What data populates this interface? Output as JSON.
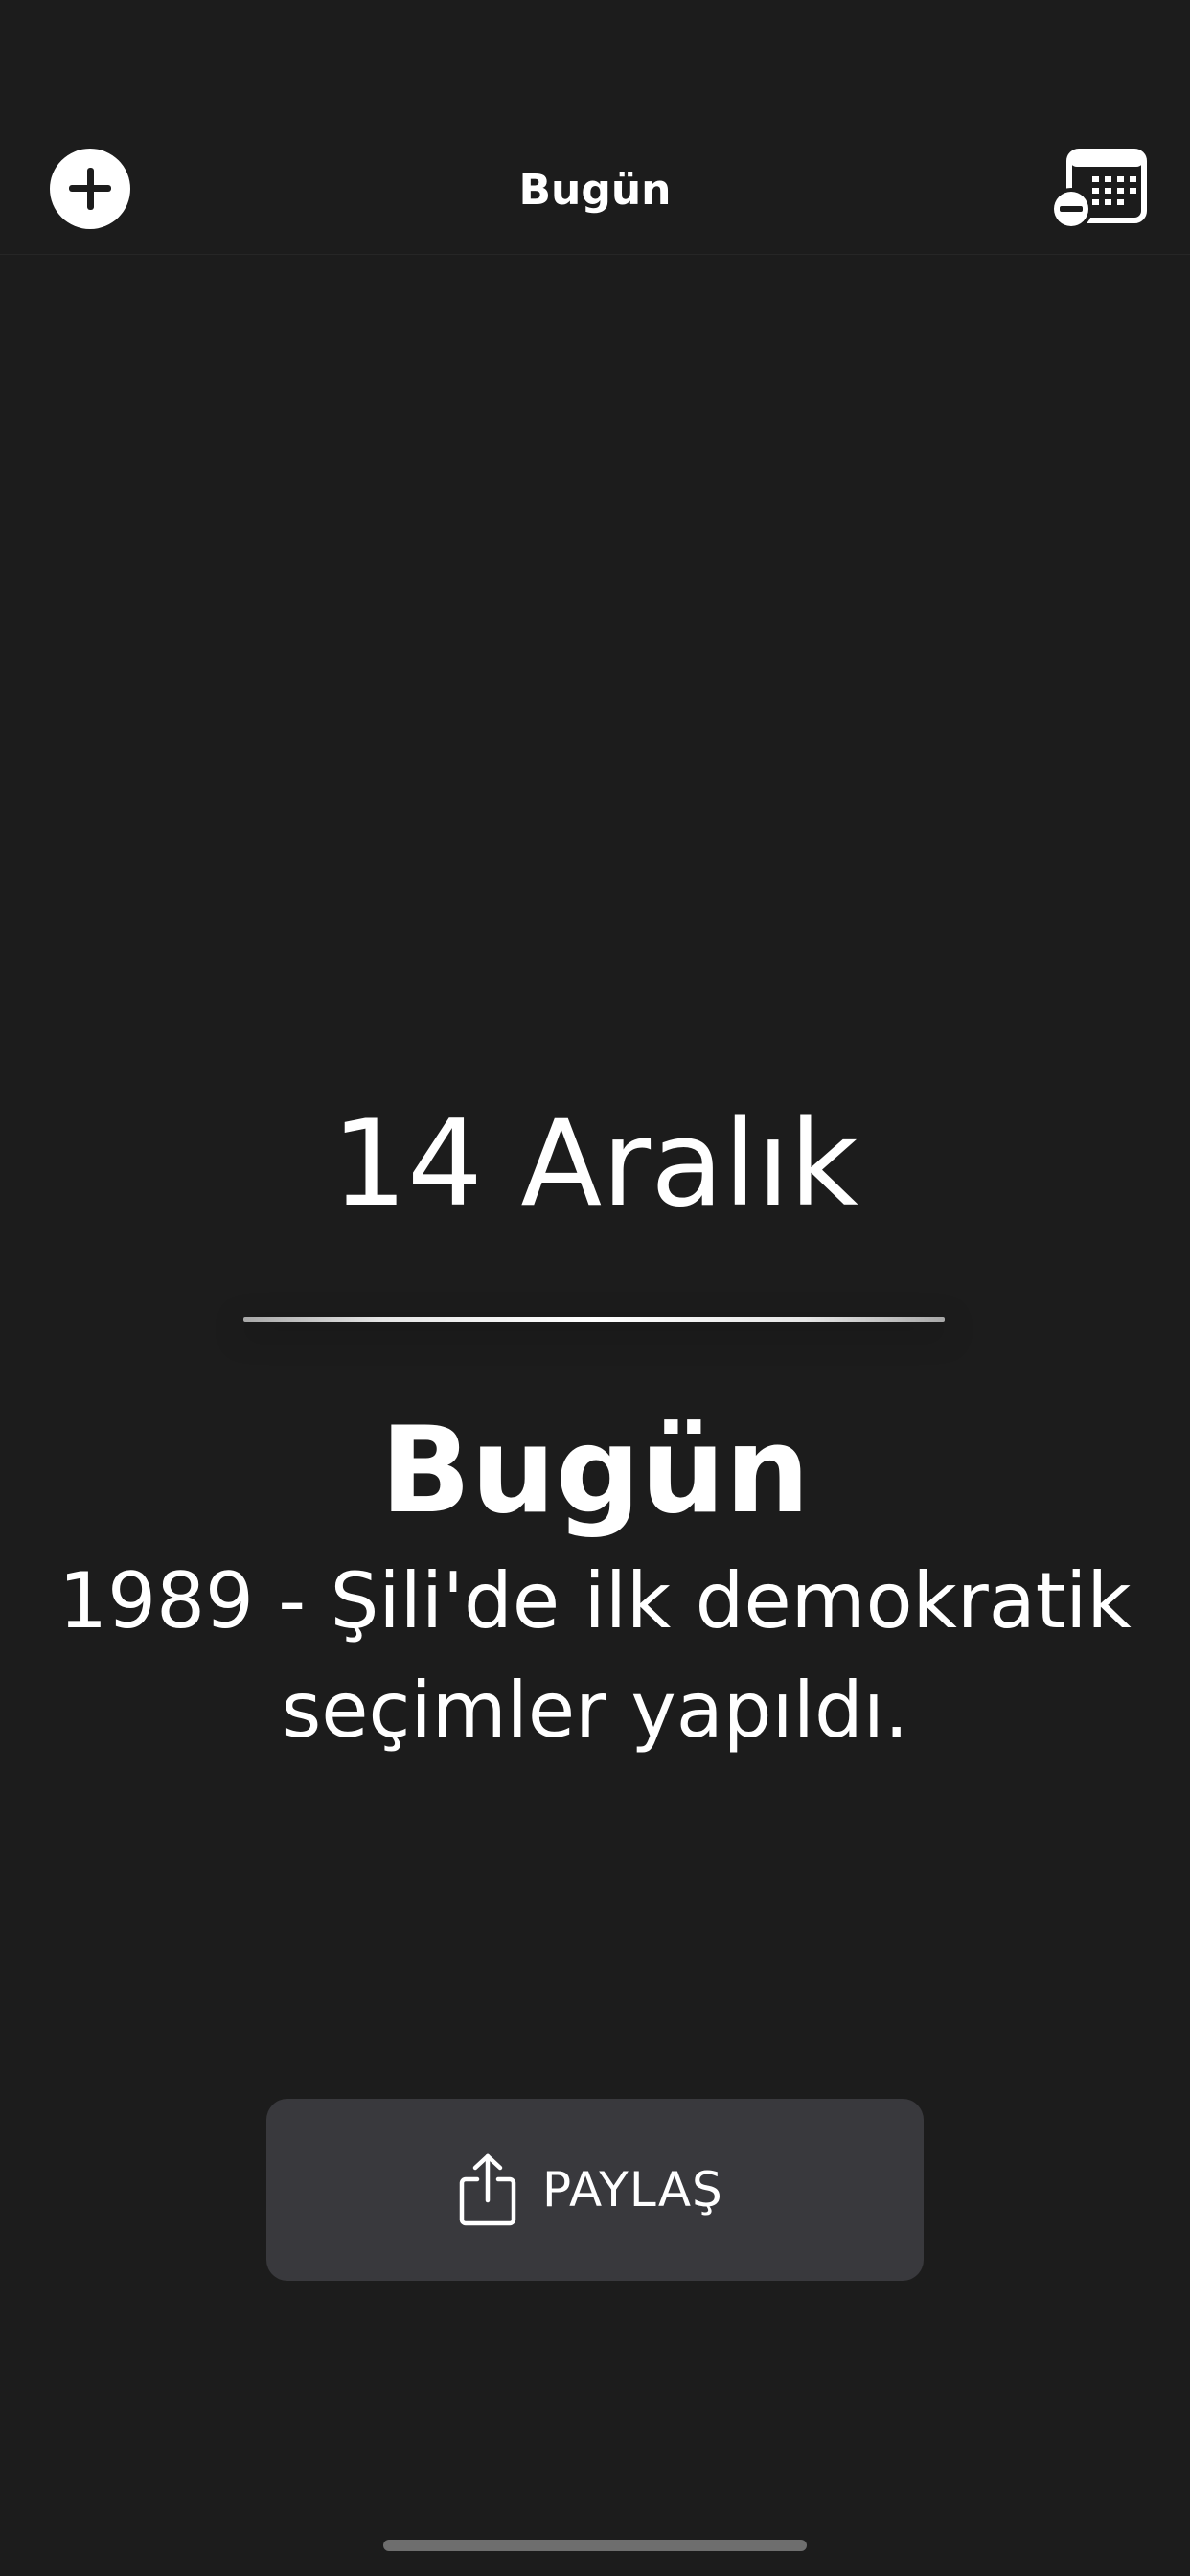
{
  "nav": {
    "title": "Bugün",
    "add_icon": "plus-circle-icon",
    "calendar_icon": "calendar-remove-icon"
  },
  "main": {
    "date": "14 Aralık",
    "heading": "Bugün",
    "event": "1989 - Şili'de ilk demokratik seçimler yapıldı."
  },
  "share": {
    "icon": "share-icon",
    "label": "PAYLAŞ"
  },
  "colors": {
    "background": "#1c1c1c",
    "button": "#39393d",
    "text": "#ffffff"
  }
}
